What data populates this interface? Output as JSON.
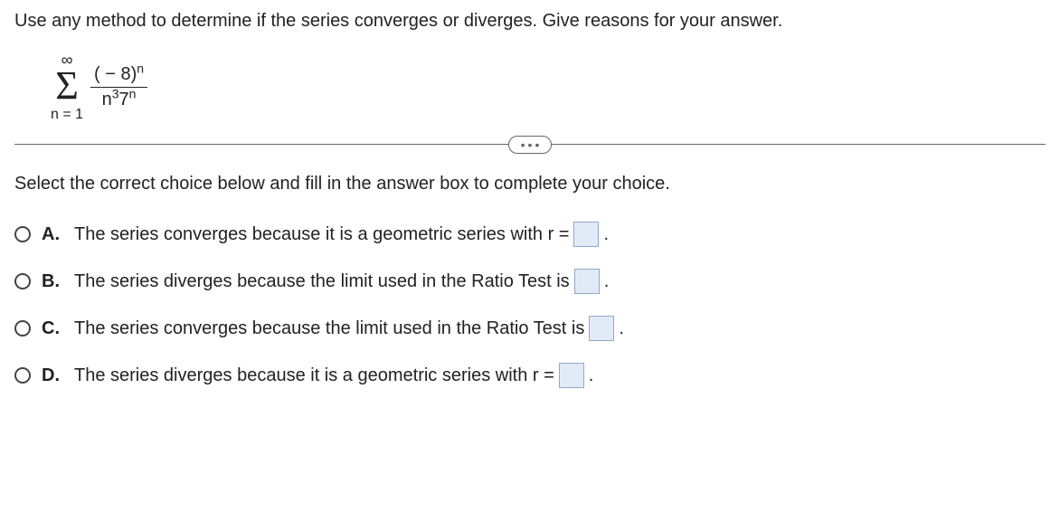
{
  "question": "Use any method to determine if the series converges or diverges. Give reasons for your answer.",
  "formula": {
    "sigma_top": "∞",
    "sigma_bottom": "n = 1",
    "numerator_base_open": "( − 8)",
    "numerator_exp": "n",
    "denom_base1": "n",
    "denom_exp1": "3",
    "denom_base2": "7",
    "denom_exp2": "n"
  },
  "instruction": "Select the correct choice below and fill in the answer box to complete your choice.",
  "choices": [
    {
      "letter": "A.",
      "pre": "The series converges because it is a geometric series with r =",
      "post": "."
    },
    {
      "letter": "B.",
      "pre": "The series diverges because the limit used in the Ratio Test is",
      "post": "."
    },
    {
      "letter": "C.",
      "pre": "The series converges because the limit used in the Ratio Test is",
      "post": "."
    },
    {
      "letter": "D.",
      "pre": "The series diverges because it is a geometric series with r =",
      "post": "."
    }
  ]
}
